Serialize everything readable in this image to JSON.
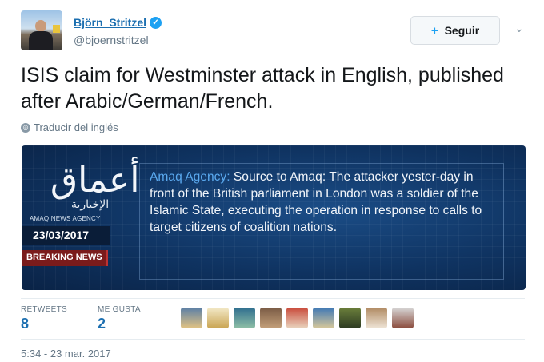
{
  "user": {
    "name": "Björn_Stritzel",
    "handle": "@bjoernstritzel",
    "verified_icon": "✓"
  },
  "follow_button": {
    "label": "Seguir",
    "icon": "+"
  },
  "tweet": {
    "text": "ISIS claim for Westminster attack in English, published after Arabic/German/French.",
    "translate": "Traducir del inglés"
  },
  "media": {
    "logo_arabic": "أعماق",
    "logo_sub_arabic": "الإخبارية",
    "logo_en": "AMAQ NEWS AGENCY",
    "date": "23/03/2017",
    "breaking": "BREAKING NEWS",
    "source": "Amaq Agency:",
    "quote": "Source to Amaq: The attacker yester-day in front of the British parliament in London was a soldier of the Islamic State, executing the operation in response to calls to target citizens of coalition nations."
  },
  "stats": {
    "retweets_label": "RETWEETS",
    "retweets": "8",
    "likes_label": "ME GUSTA",
    "likes": "2"
  },
  "likers": [
    {
      "colors": [
        "#5b7fa6",
        "#e3c483"
      ]
    },
    {
      "colors": [
        "#f3e9c8",
        "#c9a452"
      ]
    },
    {
      "colors": [
        "#2f6e8f",
        "#8fc0a6"
      ]
    },
    {
      "colors": [
        "#7a5b45",
        "#c4a07a"
      ]
    },
    {
      "colors": [
        "#c94a3a",
        "#e9d5bf"
      ]
    },
    {
      "colors": [
        "#3f78b5",
        "#d9c99a"
      ]
    },
    {
      "colors": [
        "#6b7f3b",
        "#2c3a22"
      ]
    },
    {
      "colors": [
        "#b08a62",
        "#efe5d7"
      ]
    },
    {
      "colors": [
        "#d7d7d7",
        "#8a4a3b"
      ]
    }
  ],
  "timestamp": "5:34 - 23 mar. 2017",
  "colors": {
    "link": "#1c6fb0",
    "verified": "#1da1f2",
    "muted": "#657786",
    "media_bg": "#0f3361"
  }
}
